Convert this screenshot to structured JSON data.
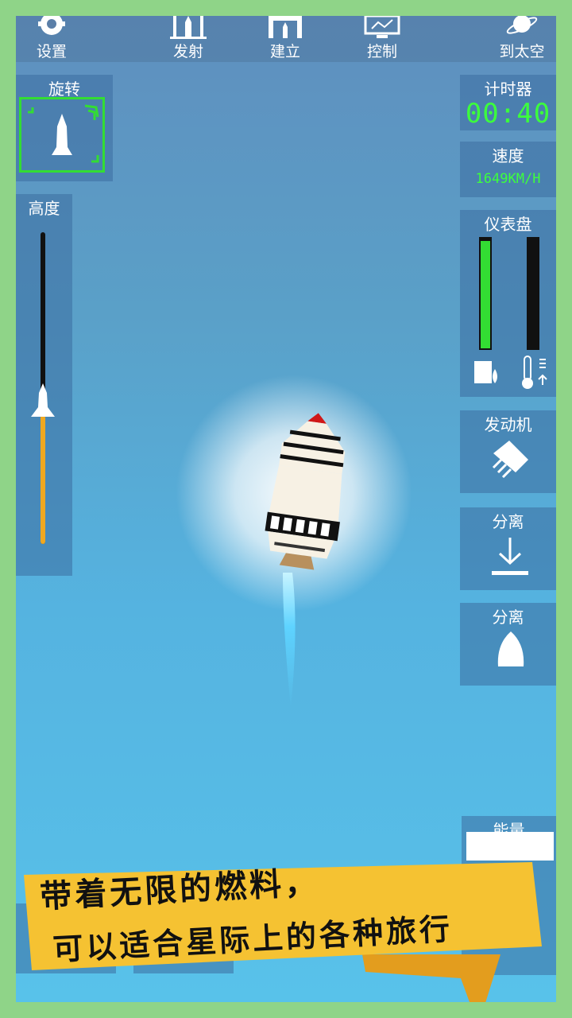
{
  "toolbar": {
    "settings": "设置",
    "launch": "发射",
    "build": "建立",
    "control": "控制",
    "to_space": "到太空"
  },
  "rotation": {
    "title": "旋转"
  },
  "altitude": {
    "title": "高度",
    "level": 0.5
  },
  "timer": {
    "title": "计时器",
    "value": "00:40"
  },
  "speed": {
    "title": "速度",
    "value": "1649KM/H"
  },
  "dashboard": {
    "title": "仪表盘",
    "fuel_level": 0.98,
    "temperature_level": 0.0
  },
  "engine": {
    "title": "发动机"
  },
  "separate1": {
    "title": "分离"
  },
  "separate2": {
    "title": "分离"
  },
  "partial": {
    "title": "能量"
  },
  "banner": {
    "line1": "带着无限的燃料，",
    "line2": "可以适合星际上的各种旅行"
  },
  "colors": {
    "frame": "#8fd488",
    "lcd": "#3cff3c",
    "banner": "#f5c232",
    "fuel": "#33dd33"
  }
}
